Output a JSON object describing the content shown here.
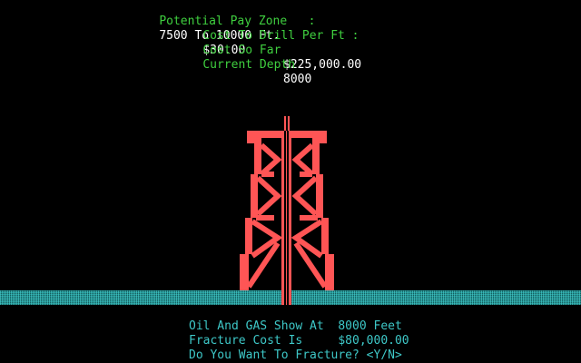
{
  "header": {
    "pay_zone_label": "Potential Pay Zone   :",
    "pay_zone_value": "7500 To 10000 Ft.",
    "cost_per_ft_label": "Cost To Drill Per Ft :",
    "cost_per_ft_value": "$30.00",
    "cost_so_far_label": "Cost So Far",
    "cost_so_far_value": "$225,000.00",
    "depth_label": "Current Depth",
    "depth_value": "8000"
  },
  "message": {
    "line1": "Oil And GAS Show At  8000 Feet",
    "line2": "Fracture Cost Is     $80,000.00",
    "prompt": "Do You Want To Fracture? <Y/N>"
  },
  "colors": {
    "label": "#3fcf3f",
    "value": "#ffffff",
    "derrick": "#ff5555",
    "ground": "#1f8f8f",
    "message": "#3ec8c8",
    "background": "#000000"
  },
  "icons": {
    "derrick": "oil-derrick-icon",
    "ground": "ground-strip"
  }
}
